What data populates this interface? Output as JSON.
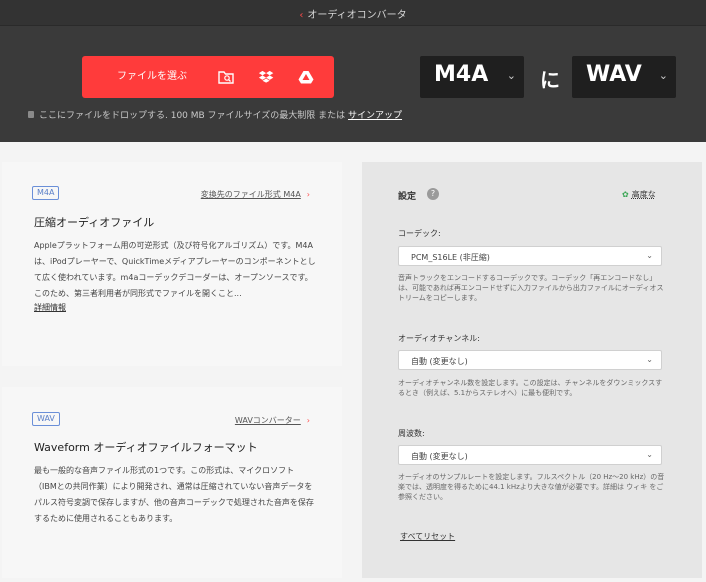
{
  "header": {
    "breadcrumb": "オーディオコンバータ",
    "choose_files_label": "ファイルを選ぶ",
    "source_icons": [
      "folder-search-icon",
      "dropbox-icon",
      "google-drive-icon"
    ],
    "drop_hint": "ここにファイルをドロップする. 100 MB ファイルサイズの最大制限 または ",
    "signup_link": "サインアップ",
    "from_format": "M4A",
    "to_word": "に",
    "to_format": "WAV"
  },
  "cards": [
    {
      "badge": "M4A",
      "link": "変換先のファイル形式 M4A",
      "title": "圧縮オーディオファイル",
      "description": "Appleプラットフォーム用の可逆形式（及び符号化アルゴリズム）です。M4Aは、iPodプレーヤーで、QuickTimeメディアプレーヤーのコンポーネントとして広く使われています。m4aコーデックデコーダーは、オープンソースです。このため、第三者利用者が同形式でファイルを開くこと...",
      "details": "詳細情報"
    },
    {
      "badge": "WAV",
      "link": "WAVコンバーター",
      "title": "Waveform オーディオファイルフォーマット",
      "description": "最も一般的な音声ファイル形式の1つです。この形式は、マイクロソフト（IBMとの共同作業）により開発され、通常は圧縮されていない音声データをパルス符号変調で保存しますが、他の音声コーデックで処理された音声を保存するために使用されることもあります。"
    }
  ],
  "settings": {
    "title": "設定",
    "advanced": "高度な",
    "codec_label": "コーデック:",
    "codec_value": "PCM_S16LE (非圧縮)",
    "codec_help": "音声トラックをエンコードするコーデックです。コーデック「再エンコードなし」は、可能であれば再エンコードせずに入力ファイルから出力ファイルにオーディオストリームをコピーします。",
    "channel_label": "オーディオチャンネル:",
    "channel_value": "自動 (変更なし)",
    "channel_help": "オーディオチャンネル数を設定します。この設定は、チャンネルをダウンミックスするとき（例えば、5.1からステレオへ）に最も便利です。",
    "freq_label": "周波数:",
    "freq_value": "自動 (変更なし)",
    "freq_help": "オーディオのサンプルレートを設定します。フルスペクトル（20 Hz〜20 kHz）の音楽では、透明度を得るために44.1 kHzより大きな値が必要です。詳細は ウィキ をご参照ください。",
    "reset": "すべてリセット"
  },
  "colors": {
    "accent": "#ff3b3b",
    "header_bg": "#3a3a3a",
    "settings_bg": "#e6e6e6"
  }
}
